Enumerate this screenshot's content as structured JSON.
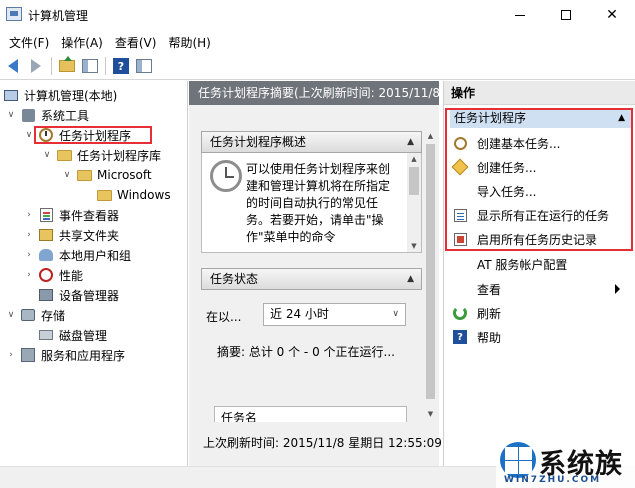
{
  "window": {
    "title": "计算机管理"
  },
  "menu": [
    "文件(F)",
    "操作(A)",
    "查看(V)",
    "帮助(H)"
  ],
  "tree": [
    {
      "label": "计算机管理(本地)",
      "icon": "computer-icon",
      "twisty": "",
      "state": "root"
    },
    {
      "label": "系统工具",
      "icon": "tools-icon",
      "twisty": "∨",
      "state": "expanded"
    },
    {
      "label": "任务计划程序",
      "icon": "clock-icon",
      "twisty": "∨",
      "state": "expanded-selected"
    },
    {
      "label": "任务计划程序库",
      "icon": "folder-icon",
      "twisty": "∨",
      "state": "expanded"
    },
    {
      "label": "Microsoft",
      "icon": "folder-icon",
      "twisty": "∨",
      "state": "expanded"
    },
    {
      "label": "Windows",
      "icon": "folder-icon",
      "twisty": "",
      "state": "leaf"
    },
    {
      "label": "事件查看器",
      "icon": "event-icon",
      "twisty": "›",
      "state": "collapsed"
    },
    {
      "label": "共享文件夹",
      "icon": "share-icon",
      "twisty": "›",
      "state": "collapsed"
    },
    {
      "label": "本地用户和组",
      "icon": "users-icon",
      "twisty": "›",
      "state": "collapsed"
    },
    {
      "label": "性能",
      "icon": "performance-icon",
      "twisty": "›",
      "state": "collapsed"
    },
    {
      "label": "设备管理器",
      "icon": "device-icon",
      "twisty": "",
      "state": "leaf"
    },
    {
      "label": "存储",
      "icon": "storage-icon",
      "twisty": "∨",
      "state": "expanded"
    },
    {
      "label": "磁盘管理",
      "icon": "disk-icon",
      "twisty": "",
      "state": "leaf"
    },
    {
      "label": "服务和应用程序",
      "icon": "services-icon",
      "twisty": "›",
      "state": "collapsed"
    }
  ],
  "middle": {
    "header": "任务计划程序摘要(上次刷新时间: 2015/11/8",
    "overview_title": "任务计划程序概述",
    "overview_text": "可以使用任务计划程序来创建和管理计算机将在所指定的时间自动执行的常见任务。若要开始，请单击\"操作\"菜单中的命令",
    "status_title": "任务状态",
    "status_label": "在以...",
    "status_value": "近 24 小时",
    "summary": "摘要: 总计 0 个 - 0 个正在运行...",
    "task_list_header": "任务名",
    "last_refresh": "上次刷新时间: 2015/11/8 星期日 12:55:09"
  },
  "actions": {
    "header": "操作",
    "group": "任务计划程序",
    "items": [
      {
        "label": "创建基本任务...",
        "icon": "basic-task-icon"
      },
      {
        "label": "创建任务...",
        "icon": "create-task-icon"
      },
      {
        "label": "导入任务...",
        "icon": ""
      },
      {
        "label": "显示所有正在运行的任务",
        "icon": "running-tasks-icon"
      },
      {
        "label": "启用所有任务历史记录",
        "icon": "history-icon"
      },
      {
        "label": "AT 服务帐户配置",
        "icon": ""
      },
      {
        "label": "查看",
        "icon": ""
      },
      {
        "label": "刷新",
        "icon": "refresh-icon"
      },
      {
        "label": "帮助",
        "icon": "help-icon"
      }
    ]
  },
  "watermark": {
    "brand": "系统族",
    "url": "WIN7ZHU.COM"
  },
  "colors": {
    "highlight": "#e52e36",
    "group_bg": "#cfe0f3",
    "header_bg": "#6f737a"
  }
}
